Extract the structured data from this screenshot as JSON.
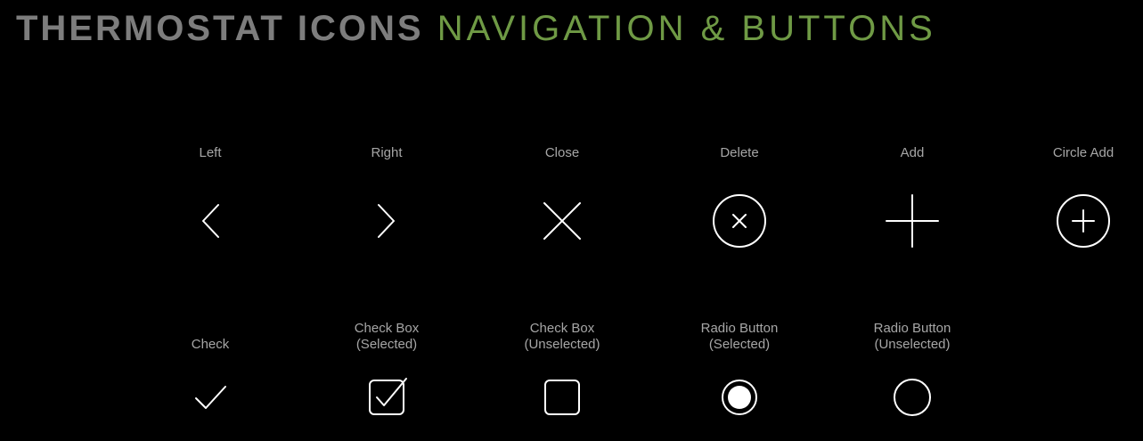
{
  "header": {
    "title_main": "THERMOSTAT ICONS",
    "title_sub": "NAVIGATION & BUTTONS"
  },
  "colors": {
    "background": "#000000",
    "title_main": "#7d7d7d",
    "title_sub": "#6f9a45",
    "label": "#a6a6a6",
    "icon": "#ffffff"
  },
  "row1": [
    {
      "label": "Left",
      "icon": "chevron-left-icon"
    },
    {
      "label": "Right",
      "icon": "chevron-right-icon"
    },
    {
      "label": "Close",
      "icon": "close-icon"
    },
    {
      "label": "Delete",
      "icon": "delete-circle-icon"
    },
    {
      "label": "Add",
      "icon": "plus-icon"
    },
    {
      "label": "Circle Add",
      "icon": "circle-add-icon"
    }
  ],
  "row2": [
    {
      "label": "Check",
      "icon": "check-icon"
    },
    {
      "label_line1": "Check Box",
      "label_line2": "(Selected)",
      "icon": "checkbox-selected-icon"
    },
    {
      "label_line1": "Check Box",
      "label_line2": "(Unselected)",
      "icon": "checkbox-unselected-icon"
    },
    {
      "label_line1": "Radio Button",
      "label_line2": "(Selected)",
      "icon": "radio-selected-icon"
    },
    {
      "label_line1": "Radio Button",
      "label_line2": "(Unselected)",
      "icon": "radio-unselected-icon"
    }
  ]
}
